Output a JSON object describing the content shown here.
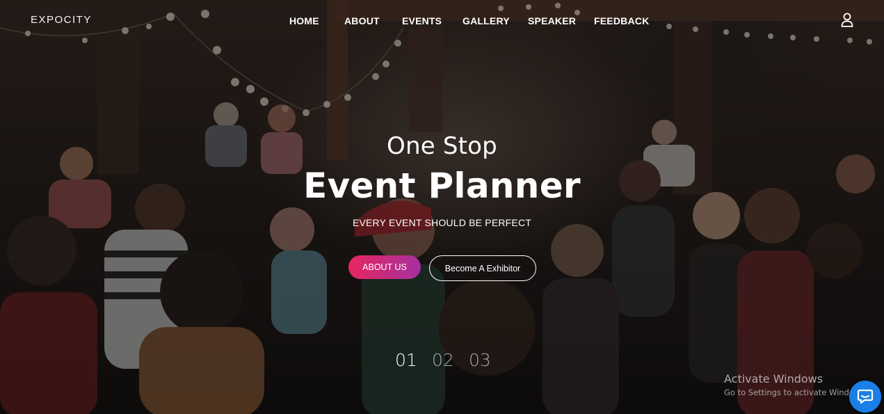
{
  "brand": {
    "logo_text": "EXPOCITY"
  },
  "nav": {
    "items": [
      {
        "label": "HOME"
      },
      {
        "label": "ABOUT"
      },
      {
        "label": "EVENTS"
      },
      {
        "label": "GALLERY"
      },
      {
        "label": "SPEAKER"
      },
      {
        "label": "FEEDBACK"
      }
    ],
    "user_icon": "user-icon"
  },
  "hero": {
    "kicker": "One Stop",
    "title": "Event Planner",
    "subtitle": "EVERY EVENT SHOULD BE PERFECT",
    "primary_button": "ABOUT US",
    "secondary_button": "Become A Exhibitor",
    "slides": [
      {
        "label": "01",
        "active": true
      },
      {
        "label": "02",
        "active": false
      },
      {
        "label": "03",
        "active": false
      }
    ]
  },
  "watermark": {
    "title": "Activate Windows",
    "subtitle": "Go to Settings to activate Windows."
  },
  "chat": {
    "icon": "chat-bubble-icon"
  },
  "colors": {
    "accent_start": "#e8265e",
    "accent_end": "#a530a0",
    "chat_blue": "#1a7fe6",
    "text": "#ffffff",
    "inactive": "#a9a9a9"
  }
}
